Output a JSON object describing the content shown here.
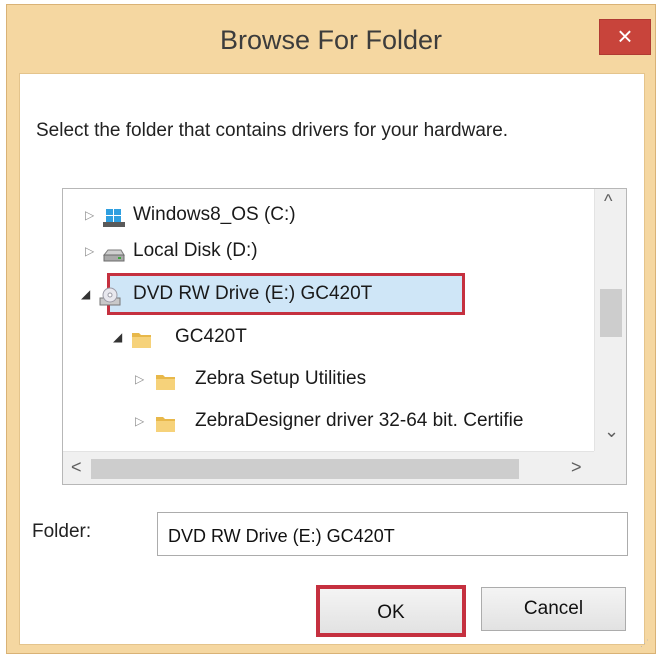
{
  "window": {
    "title": "Browse For Folder",
    "close_icon": "×"
  },
  "instruction": "Select the folder that contains drivers for your hardware.",
  "tree": {
    "items": [
      {
        "label": "Windows8_OS (C:)",
        "icon": "os-drive-icon",
        "expander": "▷",
        "level": 0,
        "selected": false
      },
      {
        "label": "Local Disk (D:)",
        "icon": "hard-disk-icon",
        "expander": "▷",
        "level": 0,
        "selected": false
      },
      {
        "label": "DVD RW Drive (E:) GC420T",
        "icon": "dvd-drive-icon",
        "expander": "◢",
        "level": 0,
        "selected": true
      },
      {
        "label": "GC420T",
        "icon": "folder-icon",
        "expander": "◢",
        "level": 1,
        "selected": false
      },
      {
        "label": "Zebra Setup Utilities",
        "icon": "folder-icon",
        "expander": "▷",
        "level": 2,
        "selected": false
      },
      {
        "label": "ZebraDesigner driver 32-64 bit. Certifie",
        "icon": "folder-icon",
        "expander": "▷",
        "level": 2,
        "selected": false
      }
    ],
    "scroll_up": "^",
    "scroll_down": "⌄",
    "scroll_left": "<",
    "scroll_right": ">"
  },
  "folder_field": {
    "label": "Folder:",
    "value": "DVD RW Drive (E:) GC420T"
  },
  "buttons": {
    "ok": "OK",
    "cancel": "Cancel"
  },
  "colors": {
    "title_bar": "#f5d7a1",
    "close_button": "#c8443b",
    "selection": "#cfe6f7",
    "highlight_box": "#c5303f"
  }
}
